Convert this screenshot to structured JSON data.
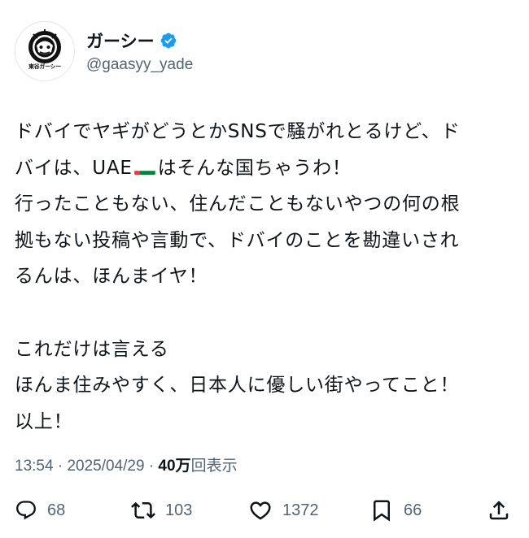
{
  "author": {
    "display_name": "ガーシー",
    "handle": "@gaasyy_yade",
    "avatar_caption": "東谷ガーシー",
    "verified_icon": "verified-badge-icon",
    "verified_color": "#1d9bf0"
  },
  "tweet": {
    "lines": [
      "ドバイでヤギがどうとかSNSで騒がれとるけど、ド",
      "バイは、UAE",
      "はそんな国ちゃうわ！",
      "行ったこともない、住んだこともないやつの何の根",
      "拠もない投稿や言動で、ドバイのことを勘違いされ",
      "るんは、ほんまイヤ！",
      "",
      "これだけは言える",
      "ほんま住みやすく、日本人に優しい街やってこと！",
      "以上！"
    ],
    "flag": "uae-flag-emoji"
  },
  "meta": {
    "time": "13:54",
    "separator": "·",
    "date": "2025/04/29",
    "views_count": "40万",
    "views_label": "回表示"
  },
  "actions": {
    "reply": {
      "icon": "reply-icon",
      "count": "68"
    },
    "retweet": {
      "icon": "retweet-icon",
      "count": "103"
    },
    "like": {
      "icon": "heart-icon",
      "count": "1372"
    },
    "bookmark": {
      "icon": "bookmark-icon",
      "count": "66"
    },
    "share": {
      "icon": "share-icon"
    }
  },
  "colors": {
    "text": "#0f1419",
    "secondary": "#536471",
    "verified": "#1d9bf0"
  }
}
